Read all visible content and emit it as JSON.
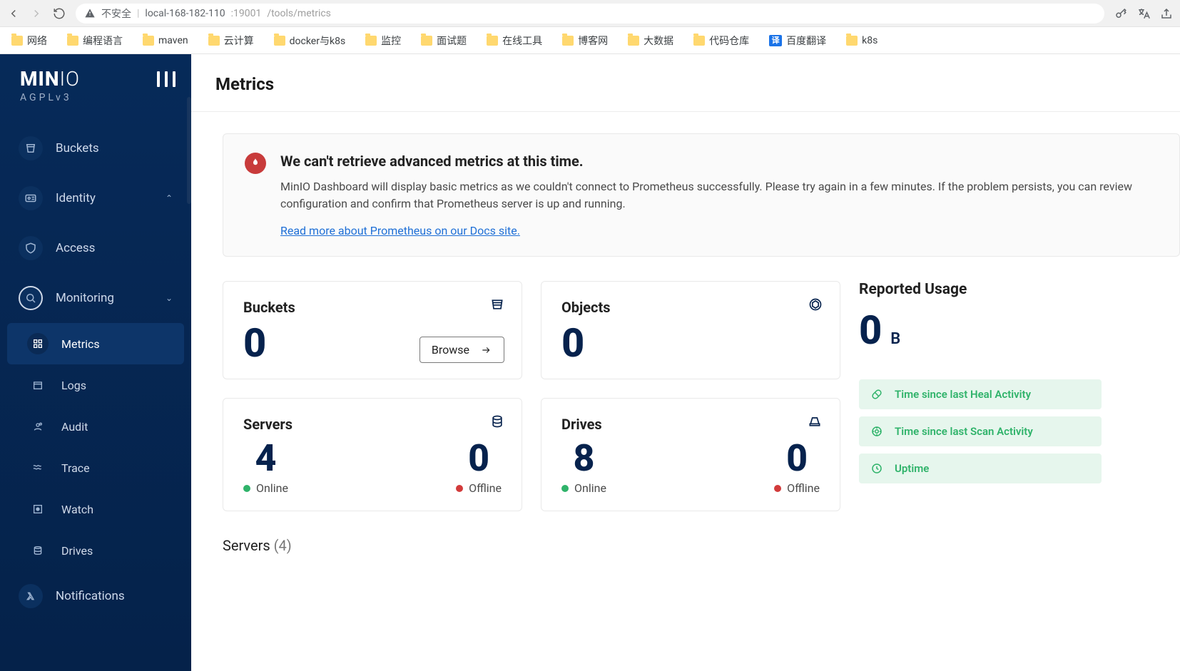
{
  "browser": {
    "insecure_label": "不安全",
    "url_host": "local-168-182-110",
    "url_port": ":19001",
    "url_path": "/tools/metrics"
  },
  "bookmarks": [
    {
      "label": "网络",
      "type": "folder"
    },
    {
      "label": "编程语言",
      "type": "folder"
    },
    {
      "label": "maven",
      "type": "folder"
    },
    {
      "label": "云计算",
      "type": "folder"
    },
    {
      "label": "docker与k8s",
      "type": "folder"
    },
    {
      "label": "监控",
      "type": "folder"
    },
    {
      "label": "面试题",
      "type": "folder"
    },
    {
      "label": "在线工具",
      "type": "folder"
    },
    {
      "label": "博客网",
      "type": "folder"
    },
    {
      "label": "大数据",
      "type": "folder"
    },
    {
      "label": "代码仓库",
      "type": "folder"
    },
    {
      "label": "百度翻译",
      "type": "translate"
    },
    {
      "label": "k8s",
      "type": "folder"
    }
  ],
  "sidebar": {
    "brand_left": "MIN",
    "brand_right": "IO",
    "license": "AGPLv3",
    "items": [
      {
        "label": "Buckets",
        "icon": "bucket"
      },
      {
        "label": "Identity",
        "icon": "card",
        "expandable": true
      },
      {
        "label": "Access",
        "icon": "shield"
      },
      {
        "label": "Monitoring",
        "icon": "search",
        "active": true,
        "expandable": true
      },
      {
        "label": "Metrics",
        "icon": "grid",
        "sub": true,
        "selected": true
      },
      {
        "label": "Logs",
        "icon": "box",
        "sub": true
      },
      {
        "label": "Audit",
        "icon": "person",
        "sub": true
      },
      {
        "label": "Trace",
        "icon": "waves",
        "sub": true
      },
      {
        "label": "Watch",
        "icon": "target",
        "sub": true
      },
      {
        "label": "Drives",
        "icon": "disks",
        "sub": true
      },
      {
        "label": "Notifications",
        "icon": "lambda"
      }
    ]
  },
  "page": {
    "title": "Metrics"
  },
  "alert": {
    "heading": "We can't retrieve advanced metrics at this time.",
    "body": "MinIO Dashboard will display basic metrics as we couldn't connect to Prometheus successfully. Please try again in a few minutes. If the problem persists, you can review configuration and confirm that Prometheus server is up and running.",
    "link": "Read more about Prometheus on our Docs site."
  },
  "cards": {
    "buckets": {
      "title": "Buckets",
      "value": "0",
      "browse": "Browse"
    },
    "objects": {
      "title": "Objects",
      "value": "0"
    },
    "servers": {
      "title": "Servers",
      "online": "4",
      "offline": "0",
      "online_label": "Online",
      "offline_label": "Offline"
    },
    "drives": {
      "title": "Drives",
      "online": "8",
      "offline": "0",
      "online_label": "Online",
      "offline_label": "Offline"
    }
  },
  "usage": {
    "title": "Reported Usage",
    "value": "0",
    "unit": "B"
  },
  "pills": [
    {
      "label": "Time since last Heal Activity",
      "icon": "heal"
    },
    {
      "label": "Time since last Scan Activity",
      "icon": "scan"
    },
    {
      "label": "Uptime",
      "icon": "clock"
    }
  ],
  "section": {
    "servers_label": "Servers",
    "servers_count": "(4)"
  }
}
